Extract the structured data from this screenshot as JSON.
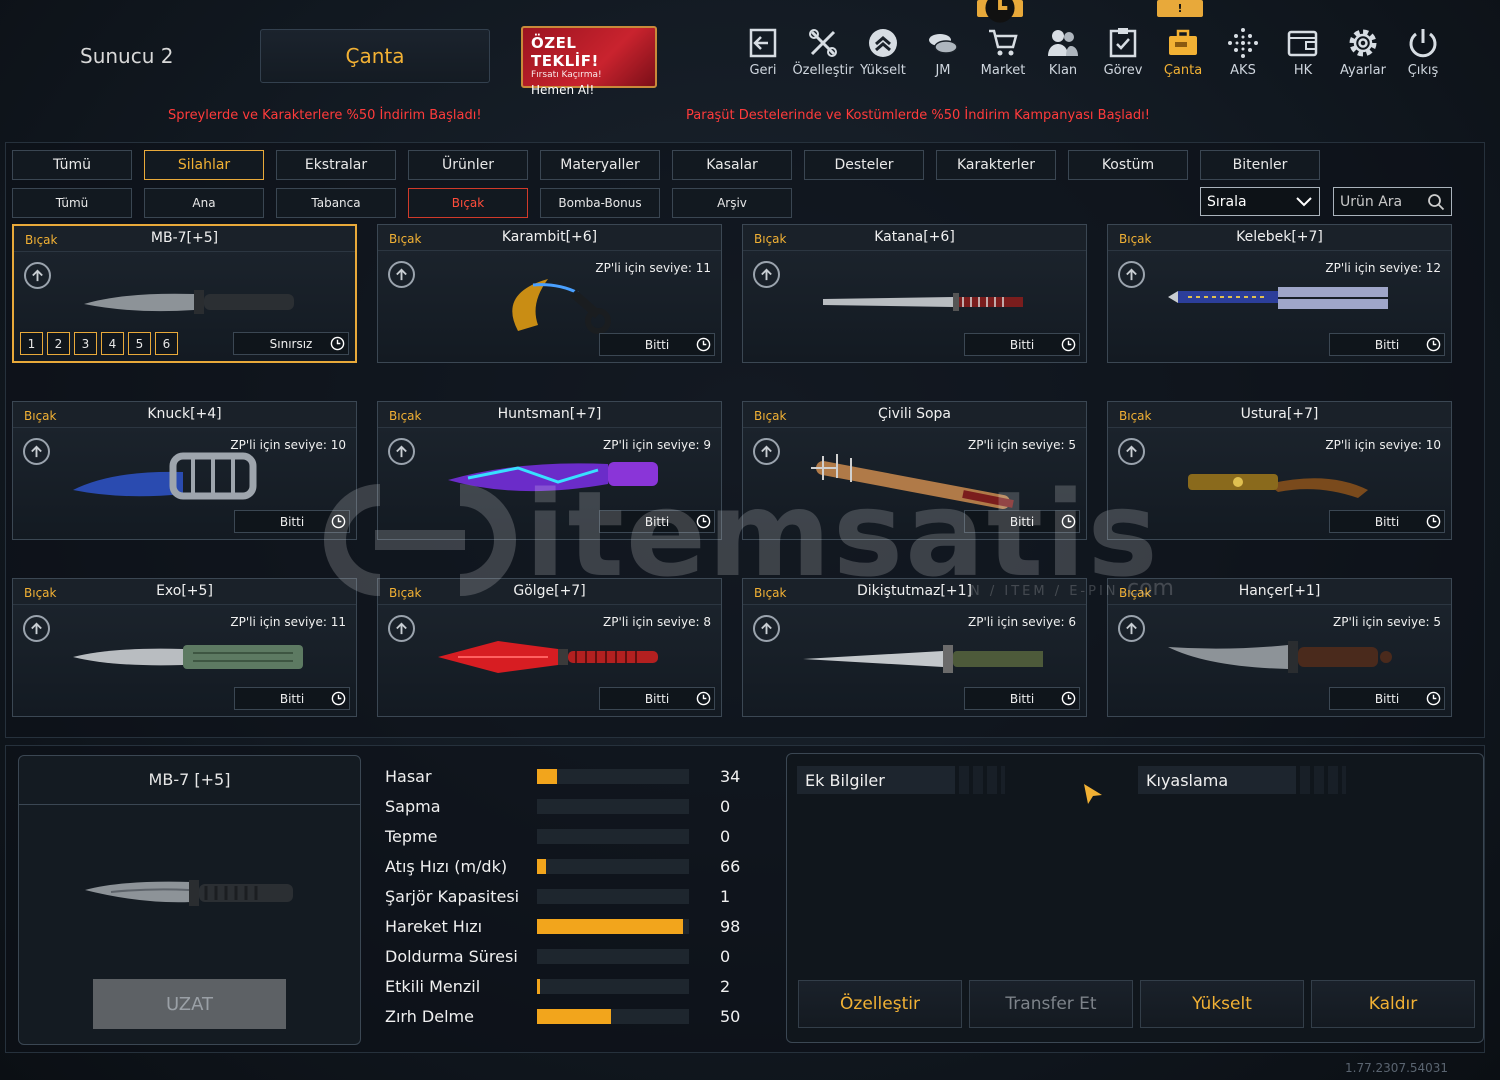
{
  "header": {
    "server": "Sunucu 2",
    "bag_title": "Çanta",
    "offer": {
      "line1": "ÖZEL TEKLİF!",
      "line2": "Fırsatı Kaçırma!",
      "line3": "Hemen Al!"
    },
    "nav": [
      {
        "label": "Geri",
        "icon": "back-icon"
      },
      {
        "label": "Özelleştir",
        "icon": "tools-icon"
      },
      {
        "label": "Yükselt",
        "icon": "upgrade-icon"
      },
      {
        "label": "JM",
        "icon": "coins-icon"
      },
      {
        "label": "Market",
        "icon": "cart-icon",
        "badge": "clock"
      },
      {
        "label": "Klan",
        "icon": "clan-icon"
      },
      {
        "label": "Görev",
        "icon": "task-icon"
      },
      {
        "label": "Çanta",
        "icon": "bag-icon",
        "badge": "!"
      },
      {
        "label": "AKS",
        "icon": "dots-icon"
      },
      {
        "label": "HK",
        "icon": "wallet-icon"
      },
      {
        "label": "Ayarlar",
        "icon": "gear-icon"
      },
      {
        "label": "Çıkış",
        "icon": "power-icon"
      }
    ]
  },
  "promos": {
    "left": "Spreylerde ve Karakterlere %50 İndirim Başladı!",
    "right": "Paraşüt Destelerinde ve Kostümlerde %50 İndirim Kampanyası Başladı!"
  },
  "categories": [
    "Tümü",
    "Silahlar",
    "Ekstralar",
    "Ürünler",
    "Materyaller",
    "Kasalar",
    "Desteler",
    "Karakterler",
    "Kostüm",
    "Bitenler"
  ],
  "subcategories": [
    "Tümü",
    "Ana",
    "Tabanca",
    "Bıçak",
    "Bomba-Bonus",
    "Arşiv"
  ],
  "sort_label": "Sırala",
  "search_placeholder": "Ürün Ara",
  "items": [
    {
      "cat": "Bıçak",
      "name": "MB-7[+5]",
      "level": "",
      "status": "Sınırsız",
      "slots": [
        "1",
        "2",
        "3",
        "4",
        "5",
        "6"
      ]
    },
    {
      "cat": "Bıçak",
      "name": "Karambit[+6]",
      "level": "ZP'li için seviye: 11",
      "status": "Bitti"
    },
    {
      "cat": "Bıçak",
      "name": "Katana[+6]",
      "level": "",
      "status": "Bitti"
    },
    {
      "cat": "Bıçak",
      "name": "Kelebek[+7]",
      "level": "ZP'li için seviye: 12",
      "status": "Bitti"
    },
    {
      "cat": "Bıçak",
      "name": "Knuck[+4]",
      "level": "ZP'li için seviye: 10",
      "status": "Bitti"
    },
    {
      "cat": "Bıçak",
      "name": "Huntsman[+7]",
      "level": "ZP'li için seviye: 9",
      "status": "Bitti"
    },
    {
      "cat": "Bıçak",
      "name": "Çivili Sopa",
      "level": "ZP'li için seviye: 5",
      "status": "Bitti"
    },
    {
      "cat": "Bıçak",
      "name": "Ustura[+7]",
      "level": "ZP'li için seviye: 10",
      "status": "Bitti"
    },
    {
      "cat": "Bıçak",
      "name": "Exo[+5]",
      "level": "ZP'li için seviye: 11",
      "status": "Bitti"
    },
    {
      "cat": "Bıçak",
      "name": "Gölge[+7]",
      "level": "ZP'li için seviye: 8",
      "status": "Bitti"
    },
    {
      "cat": "Bıçak",
      "name": "Dikiştutmaz[+1]",
      "level": "ZP'li için seviye: 6",
      "status": "Bitti"
    },
    {
      "cat": "Bıçak",
      "name": "Hançer[+1]",
      "level": "ZP'li için seviye: 5",
      "status": "Bitti"
    }
  ],
  "selected": {
    "title": "MB-7 [+5]",
    "extend_button": "UZAT",
    "stats": [
      {
        "label": "Hasar",
        "value": "34",
        "fill": 0.13
      },
      {
        "label": "Sapma",
        "value": "0",
        "fill": 0
      },
      {
        "label": "Tepme",
        "value": "0",
        "fill": 0
      },
      {
        "label": "Atış Hızı (m/dk)",
        "value": "66",
        "fill": 0.06
      },
      {
        "label": "Şarjör Kapasitesi",
        "value": "1",
        "fill": 0
      },
      {
        "label": "Hareket Hızı",
        "value": "98",
        "fill": 0.96
      },
      {
        "label": "Doldurma Süresi",
        "value": "0",
        "fill": 0
      },
      {
        "label": "Etkili Menzil",
        "value": "2",
        "fill": 0.015
      },
      {
        "label": "Zırh Delme",
        "value": "50",
        "fill": 0.49
      }
    ]
  },
  "info": {
    "tab1": "Ek Bilgiler",
    "tab2": "Kıyaslama",
    "actions": [
      "Özelleştir",
      "Transfer Et",
      "Yükselt",
      "Kaldır"
    ]
  },
  "watermark": {
    "brand": "itemsatis",
    "tagline": "N / ITEM / E-PIN",
    "suffix": ".com"
  },
  "version": "1.77.2307.54031"
}
